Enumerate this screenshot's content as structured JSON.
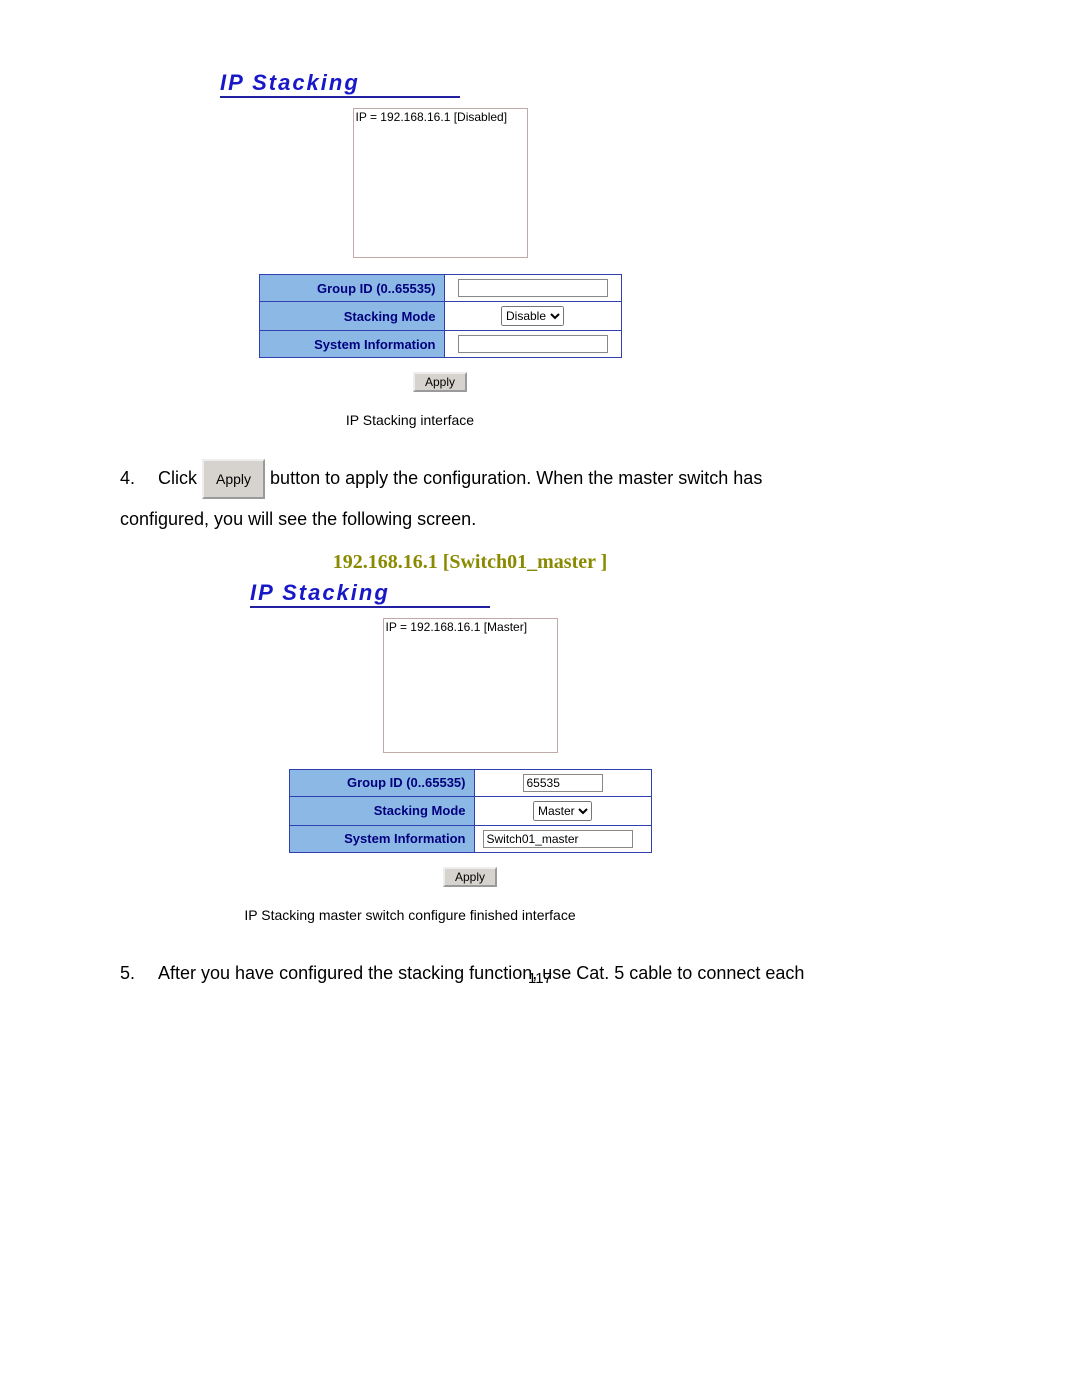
{
  "panel1": {
    "heading": "IP Stacking",
    "list_item": "IP = 192.168.16.1 [Disabled]",
    "group_id_label": "Group ID (0..65535)",
    "group_id_value": "",
    "mode_label": "Stacking Mode",
    "mode_value": "Disable",
    "sys_label": "System Information",
    "sys_value": "",
    "apply_label": "Apply"
  },
  "caption1": "IP Stacking interface",
  "step4": {
    "num": "4.",
    "pre": "Click ",
    "apply_label": "Apply",
    "post1": " button to apply the configuration. When the master switch has",
    "post2": "configured, you will see the following screen."
  },
  "panel2": {
    "context_title": "192.168.16.1 [Switch01_master ]",
    "heading": "IP Stacking",
    "list_item": "IP = 192.168.16.1 [Master]",
    "group_id_label": "Group ID (0..65535)",
    "group_id_value": "65535",
    "mode_label": "Stacking Mode",
    "mode_value": "Master",
    "sys_label": "System Information",
    "sys_value": "Switch01_master",
    "apply_label": "Apply"
  },
  "caption2": "IP Stacking master switch configure finished interface",
  "step5": {
    "num": "5.",
    "text": "After you have configured the stacking function, use Cat. 5 cable to connect each"
  },
  "page_number": "117"
}
